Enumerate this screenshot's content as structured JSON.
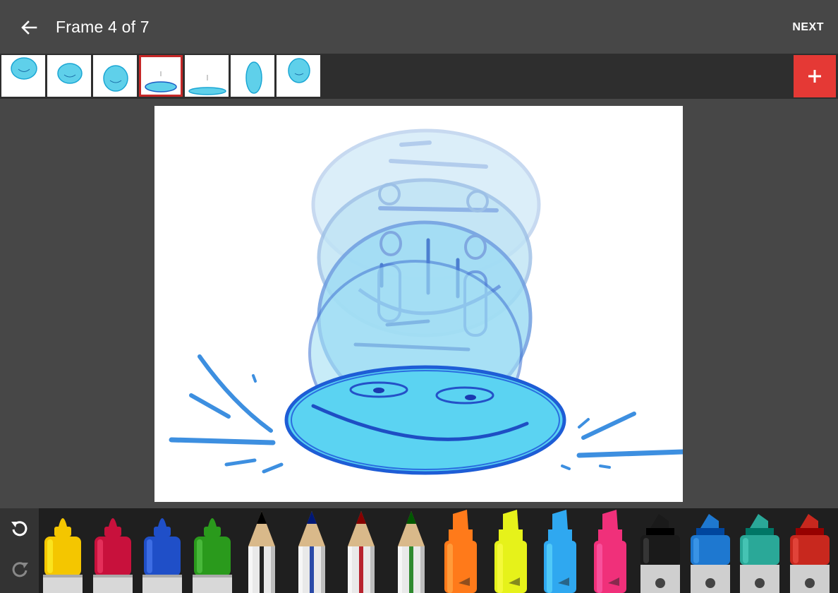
{
  "header": {
    "title": "Frame 4 of 7",
    "next_label": "NEXT"
  },
  "frames": {
    "count": 7,
    "selected": 4
  },
  "colors": {
    "accent": "#e53935",
    "selected_border": "#c62828",
    "toolbar_bg": "#474747",
    "strip_bg": "#2e2e2e",
    "tray_bg": "#1f1f1f"
  },
  "tools": [
    {
      "name": "yellow-marker",
      "kind": "marker",
      "color": "#f4c600"
    },
    {
      "name": "red-marker",
      "kind": "marker",
      "color": "#c8113c"
    },
    {
      "name": "blue-marker",
      "kind": "marker",
      "color": "#1f4fc8"
    },
    {
      "name": "green-marker",
      "kind": "marker",
      "color": "#2a9a1c"
    },
    {
      "name": "black-pencil",
      "kind": "pencil",
      "color": "#222222"
    },
    {
      "name": "blue-pencil",
      "kind": "pencil",
      "color": "#2a4aa8"
    },
    {
      "name": "red-pencil",
      "kind": "pencil",
      "color": "#b8232e"
    },
    {
      "name": "green-pencil",
      "kind": "pencil",
      "color": "#2f8a2f"
    },
    {
      "name": "orange-highlighter",
      "kind": "highlighter",
      "color": "#ff7a1a"
    },
    {
      "name": "yellow-highlighter",
      "kind": "highlighter",
      "color": "#e6f21a"
    },
    {
      "name": "lightblue-highlighter",
      "kind": "highlighter",
      "color": "#2fa8f0"
    },
    {
      "name": "pink-highlighter",
      "kind": "highlighter",
      "color": "#f0307a"
    },
    {
      "name": "black-paint-marker",
      "kind": "paint",
      "color": "#1a1a1a"
    },
    {
      "name": "blue-paint-marker",
      "kind": "paint",
      "color": "#1e78d0"
    },
    {
      "name": "teal-paint-marker",
      "kind": "paint",
      "color": "#2aa898"
    },
    {
      "name": "red-paint-marker",
      "kind": "paint",
      "color": "#c8281e"
    }
  ]
}
